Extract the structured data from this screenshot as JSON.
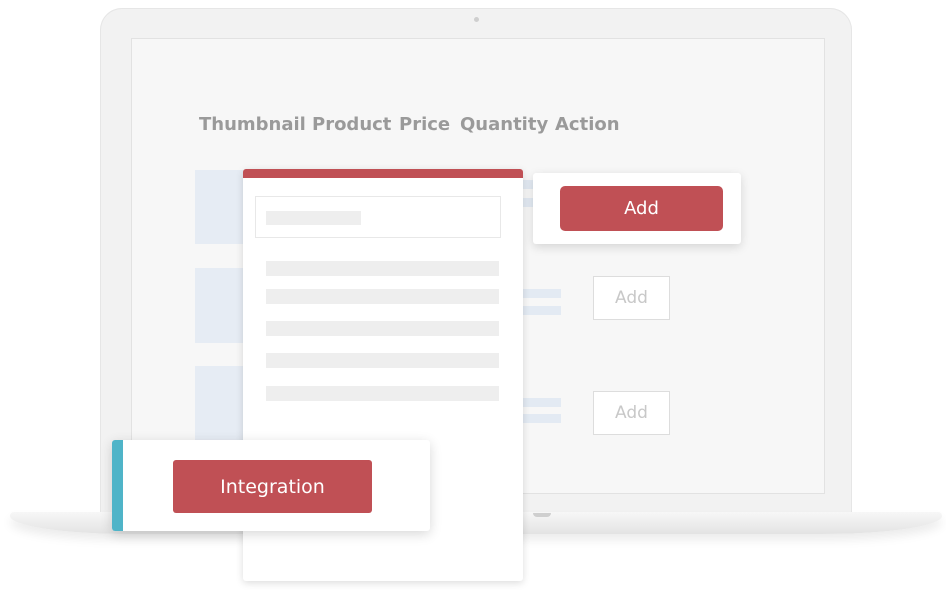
{
  "table": {
    "headers": [
      "Thumbnail",
      "Product",
      "Price",
      "Quantity",
      "Action"
    ]
  },
  "rows": [
    {
      "action_label": "Add"
    },
    {
      "action_label": "Add"
    },
    {
      "action_label": "Add"
    }
  ],
  "integration": {
    "button_label": "Integration"
  },
  "colors": {
    "accent_red": "#c05055",
    "accent_teal": "#4fb4c8",
    "thumb_placeholder": "#e6ecf4",
    "header_text": "#9a9a9a"
  }
}
